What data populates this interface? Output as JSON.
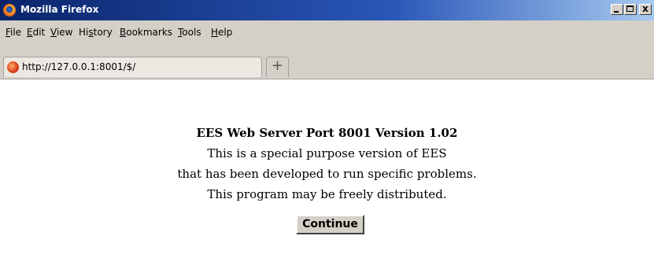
{
  "window": {
    "title": "Mozilla Firefox",
    "minimize_label": "_",
    "maximize_label": "□",
    "close_label": "x"
  },
  "menubar": {
    "items": [
      {
        "label_prefix": "",
        "accel": "F",
        "label_suffix": "ile"
      },
      {
        "label_prefix": "",
        "accel": "E",
        "label_suffix": "dit"
      },
      {
        "label_prefix": "",
        "accel": "V",
        "label_suffix": "iew"
      },
      {
        "label_prefix": "Hi",
        "accel": "s",
        "label_suffix": "tory"
      },
      {
        "label_prefix": "",
        "accel": "B",
        "label_suffix": "ookmarks"
      },
      {
        "label_prefix": "",
        "accel": "T",
        "label_suffix": "ools"
      },
      {
        "label_prefix": "",
        "accel": "H",
        "label_suffix": "elp"
      }
    ]
  },
  "tabs": {
    "active": {
      "label": "http://127.0.0.1:8001/$/"
    },
    "new_tab_label": "+"
  },
  "page": {
    "heading": "EES Web Server Port 8001 Version 1.02",
    "line1": "This is a special purpose version of EES",
    "line2": "that has been developed to run specific problems.",
    "line3": "This program may be freely distributed.",
    "continue_label": "Continue"
  }
}
